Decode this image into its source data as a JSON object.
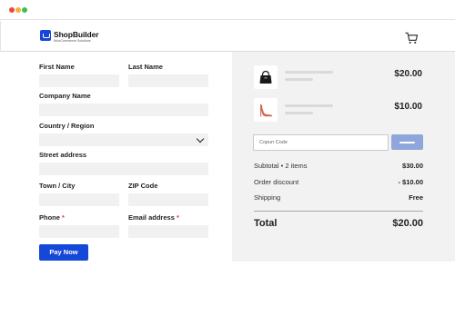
{
  "header": {
    "brand_name": "ShopBuilder",
    "brand_tagline": "WooCommerce Solutions",
    "cart_icon": "shopping-cart-icon"
  },
  "form": {
    "first_name_label": "First Name",
    "last_name_label": "Last Name",
    "company_label": "Company Name",
    "country_label": "Country / Region",
    "street_label": "Street address",
    "town_label": "Town / City",
    "zip_label": "ZIP Code",
    "phone_label": "Phone",
    "email_label": "Email address",
    "required_mark": "*",
    "pay_button": "Pay Now"
  },
  "summary": {
    "items": [
      {
        "icon": "handbag-icon",
        "price": "$20.00"
      },
      {
        "icon": "high-heel-shoe-icon",
        "price": "$10.00"
      }
    ],
    "coupon_placeholder": "Copun Code",
    "subtotal_label": "Subtotal • 2 items",
    "subtotal_value": "$30.00",
    "discount_label": "Order discount",
    "discount_value": "- $10.00",
    "shipping_label": "Shipping",
    "shipping_value": "Free",
    "total_label": "Total",
    "total_value": "$20.00"
  },
  "colors": {
    "accent": "#1547d8",
    "apply_button": "#8fa6dd",
    "panel_bg": "#f2f2f2"
  }
}
